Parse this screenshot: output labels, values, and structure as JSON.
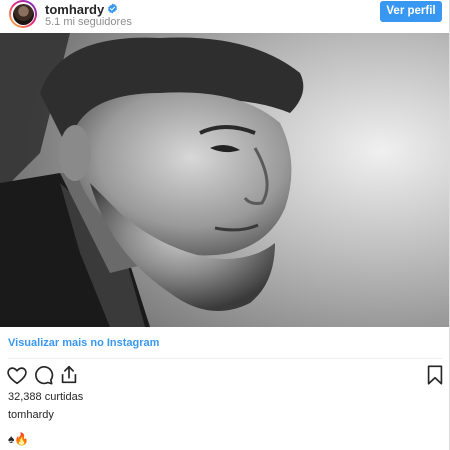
{
  "header": {
    "username": "tomhardy",
    "followers": "5.1 mi seguidores",
    "view_profile_label": "Ver perfil",
    "verified_icon": "verified-badge-icon"
  },
  "post": {
    "image_description_icon": "photo",
    "view_more_link": "Visualizar mais no Instagram",
    "likes": "32,388 curtidas",
    "caption_user": "tomhardy",
    "caption_text": "♠🔥"
  },
  "icons": {
    "like": "heart-icon",
    "comment": "comment-icon",
    "share": "share-icon",
    "save": "bookmark-icon"
  },
  "colors": {
    "accent": "#3897f0",
    "text": "#262626",
    "muted": "#8e8e8e"
  }
}
